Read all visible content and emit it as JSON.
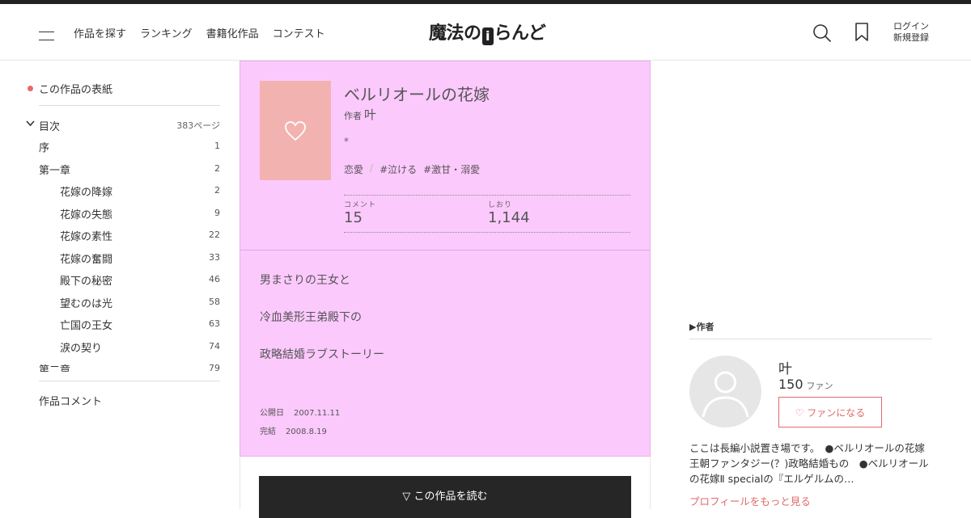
{
  "header": {
    "nav": [
      "作品を探す",
      "ランキング",
      "書籍化作品",
      "コンテスト"
    ],
    "logo_pre": "魔法の",
    "logo_i": "i",
    "logo_post": "らんど",
    "login": "ログイン",
    "signup": "新規登録"
  },
  "sidebar": {
    "cover_link": "この作品の表紙",
    "toc_label": "目次",
    "toc_count": "383ページ",
    "toc": [
      {
        "title": "序",
        "page": "1",
        "level": 1
      },
      {
        "title": "第一章",
        "page": "2",
        "level": 1
      },
      {
        "title": "花嫁の降嫁",
        "page": "2",
        "level": 2
      },
      {
        "title": "花嫁の失態",
        "page": "9",
        "level": 2
      },
      {
        "title": "花嫁の素性",
        "page": "22",
        "level": 2
      },
      {
        "title": "花嫁の奮闘",
        "page": "33",
        "level": 2
      },
      {
        "title": "殿下の秘密",
        "page": "46",
        "level": 2
      },
      {
        "title": "望むのは光",
        "page": "58",
        "level": 2
      },
      {
        "title": "亡国の王女",
        "page": "63",
        "level": 2
      },
      {
        "title": "涙の契り",
        "page": "74",
        "level": 2
      },
      {
        "title": "第二章",
        "page": "79",
        "level": 1
      }
    ],
    "comment_link": "作品コメント"
  },
  "work": {
    "title": "ベルリオールの花嫁",
    "author_label": "作者",
    "author": "叶",
    "catch": "*",
    "genre": "恋愛",
    "tag1": "#泣ける",
    "tag2": "#激甘・溺愛",
    "comment_label": "コメント",
    "comment_count": "15",
    "bookmark_label": "しおり",
    "bookmark_count": "1,144",
    "description": [
      "男まさりの王女と",
      "冷血美形王弟殿下の",
      "政略結婚ラブストーリー"
    ],
    "published_label": "公開日",
    "published": "2007.11.11",
    "completed_label": "完結",
    "completed": "2008.8.19",
    "read_button": "▽ この作品を読む"
  },
  "author_panel": {
    "heading": "▶作者",
    "name": "叶",
    "fans": "150",
    "fans_unit": "ファン",
    "fan_button": "♡ ファンになる",
    "bio": "ここは長編小説置き場です。　●ベルリオールの花嫁 王朝ファンタジー(？)政略結婚もの　●ベルリオールの花嫁Ⅱ specialの『エルゲルムの…",
    "more_link": "プロフィールをもっと見る"
  },
  "colors": {
    "card_bg": "#fcc9fd",
    "cover_bg": "#f2b3b0",
    "accent_red": "#e06a6a",
    "button_dark": "#262626"
  },
  "icons": [
    "menu-icon",
    "search-icon",
    "bookmark-icon",
    "heart-icon",
    "chevron-down-icon",
    "user-silhouette-icon"
  ]
}
